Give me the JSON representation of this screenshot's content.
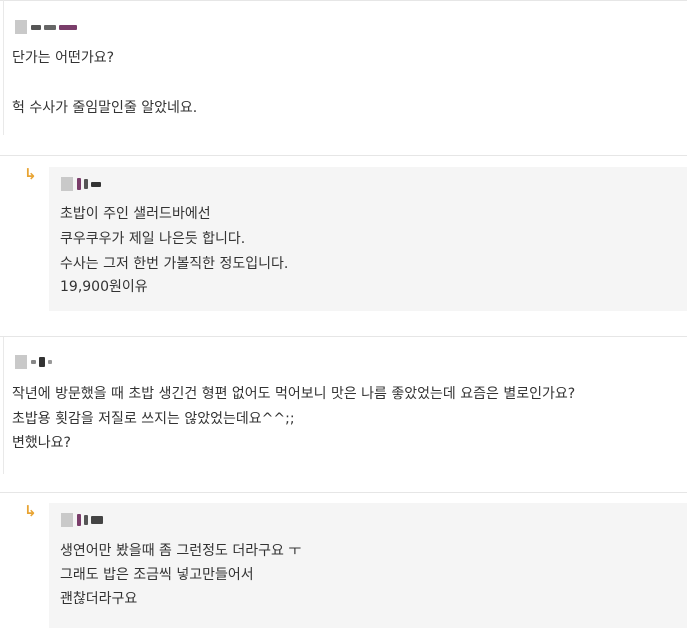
{
  "comments": [
    {
      "author": "",
      "lines": [
        "단가는 어떤가요?",
        "",
        "헉 수사가 줄임말인줄 알았네요."
      ]
    },
    {
      "is_reply": true,
      "author": "",
      "lines": [
        "초밥이 주인 샐러드바에선",
        "쿠우쿠우가 제일 나은듯 합니다.",
        "수사는 그저 한번 가볼직한 정도입니다.",
        "19,900원이유"
      ]
    },
    {
      "author": "",
      "lines": [
        "작년에 방문했을 때 초밥 생긴건 형편 없어도 먹어보니 맛은 나름 좋았었는데 요즘은 별로인가요?",
        "초밥용 횟감을 저질로 쓰지는 않았었는데요^^;;",
        "변했나요?"
      ]
    },
    {
      "is_reply": true,
      "author": "",
      "lines": [
        "생연어만 봤을때 좀 그런정도 더라구요 ㅜ",
        "그래도 밥은 조금씩 넣고만들어서",
        "괜찮더라구요"
      ]
    }
  ],
  "icons": {
    "reply": "reply-arrow-icon",
    "avatar": "avatar-icon"
  },
  "colors": {
    "reply_arrow": "#e8a433",
    "reply_bg": "#f5f5f5",
    "divider": "#e6e6e6",
    "text": "#333333"
  }
}
